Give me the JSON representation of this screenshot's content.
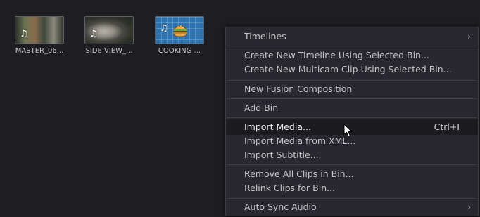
{
  "clips": [
    {
      "name": "MASTER_06...",
      "icon": "music-note-icon"
    },
    {
      "name": "SIDE VIEW_...",
      "icon": "music-note-icon"
    },
    {
      "name": "COOKING ...",
      "icon": "music-note-icon"
    }
  ],
  "menu": {
    "timelines": "Timelines",
    "create_timeline": "Create New Timeline Using Selected Bin...",
    "create_multicam": "Create New Multicam Clip Using Selected Bin...",
    "new_fusion": "New Fusion Composition",
    "add_bin": "Add Bin",
    "import_media": "Import Media...",
    "import_media_shortcut": "Ctrl+I",
    "import_xml": "Import Media from XML...",
    "import_subtitle": "Import Subtitle...",
    "remove_all": "Remove All Clips in Bin...",
    "relink": "Relink Clips for Bin...",
    "auto_sync": "Auto Sync Audio",
    "submenu_glyph": "›"
  },
  "colors": {
    "background": "#1d1d22",
    "menu_background": "#28282e",
    "menu_hover": "#1b1b20",
    "selected_clip_blue": "#2c74b1"
  }
}
